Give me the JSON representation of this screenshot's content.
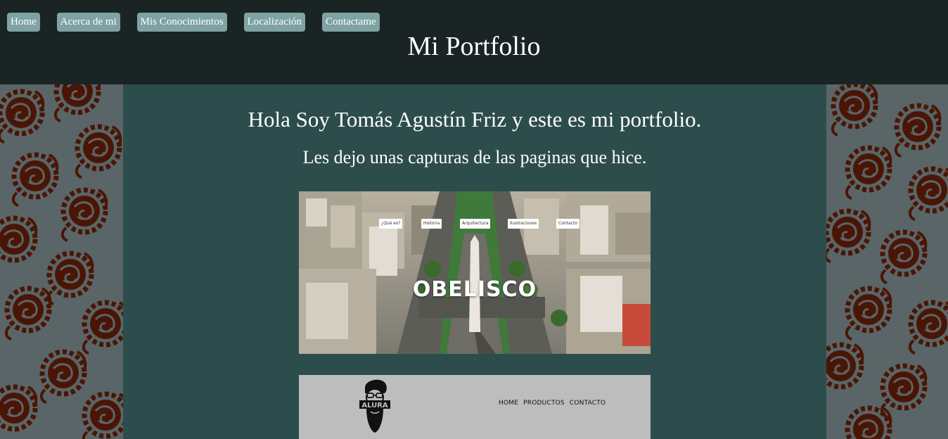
{
  "nav": {
    "items": [
      {
        "label": "Home"
      },
      {
        "label": "Acerca de mi"
      },
      {
        "label": "Mis Conocimientos"
      },
      {
        "label": "Localización"
      },
      {
        "label": "Contactame"
      }
    ]
  },
  "header": {
    "title": "Mi Portfolio"
  },
  "main": {
    "greeting": "Hola Soy Tomás Agustín Friz y este es mi portfolio.",
    "subtitle": "Les dejo unas capturas de las paginas que hice."
  },
  "screenshot1": {
    "nav": [
      "¿Qué es?",
      "Historia",
      "Arquitectura",
      "Ilustraciones",
      "Contacto"
    ],
    "heading": "OBELISCO"
  },
  "screenshot2": {
    "logo_text": "ALURA",
    "nav": [
      "HOME",
      "PRODUCTOS",
      "CONTACTO"
    ]
  },
  "colors": {
    "header_bg": "#1a2424",
    "main_bg": "#2d4d4d",
    "nav_button_bg": "#7fa2a2",
    "pattern_bg": "#5a6567",
    "pattern_fg": "#4a1505"
  }
}
